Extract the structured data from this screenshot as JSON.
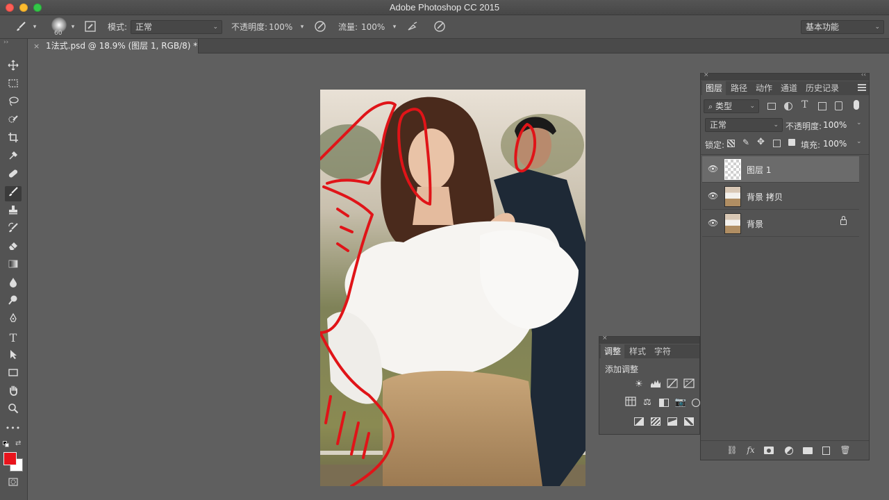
{
  "window": {
    "title": "Adobe Photoshop CC 2015"
  },
  "options_bar": {
    "brush_size": "60",
    "mode_label": "模式:",
    "mode_value": "正常",
    "opacity_label": "不透明度:",
    "opacity_value": "100%",
    "flow_label": "流量:",
    "flow_value": "100%",
    "workspace": "基本功能"
  },
  "document": {
    "tab_label": "1法式.psd @ 18.9% (图层 1, RGB/8) *",
    "close": "×"
  },
  "toolbar": {
    "tools": [
      "move-icon",
      "marquee-icon",
      "lasso-icon",
      "quick-select-icon",
      "crop-icon",
      "eyedropper-icon",
      "healing-icon",
      "brush-icon",
      "stamp-icon",
      "history-brush-icon",
      "eraser-icon",
      "gradient-icon",
      "blur-icon",
      "dodge-icon",
      "pen-icon",
      "type-icon",
      "path-select-icon",
      "rectangle-icon",
      "hand-icon",
      "zoom-icon",
      "more-icon"
    ],
    "more": "•••",
    "type_glyph": "T",
    "foreground_color": "#e8141c",
    "background_color": "#ffffff"
  },
  "layers_panel": {
    "tabs": [
      "图层",
      "路径",
      "动作",
      "通道",
      "历史记录"
    ],
    "filter_label": "类型",
    "blend_mode": "正常",
    "opacity_label": "不透明度:",
    "opacity_value": "100%",
    "lock_label": "锁定:",
    "fill_label": "填充:",
    "fill_value": "100%",
    "layers": [
      {
        "name": "图层 1",
        "selected": true,
        "locked": false
      },
      {
        "name": "背景 拷贝",
        "selected": false,
        "locked": false
      },
      {
        "name": "背景",
        "selected": false,
        "locked": true
      }
    ],
    "footer_icons": [
      "link-icon",
      "fx-icon",
      "mask-icon",
      "adjustment-icon",
      "folder-icon",
      "new-layer-icon",
      "trash-icon"
    ],
    "fx": "fx"
  },
  "adjustments_panel": {
    "tabs": [
      "调整",
      "样式",
      "字符"
    ],
    "heading": "添加调整"
  },
  "colors": {
    "accent_red": "#e8141c",
    "panel_bg": "#535353",
    "canvas_bg": "#5f5f5f"
  }
}
